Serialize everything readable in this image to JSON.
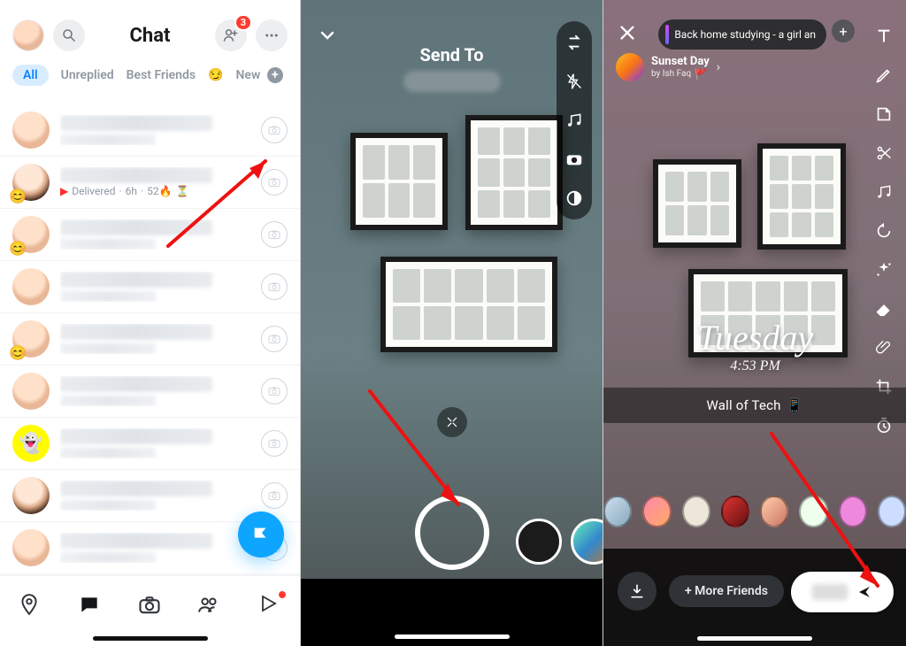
{
  "phone1": {
    "header": {
      "title": "Chat",
      "notif_count": "3"
    },
    "filters": {
      "all": "All",
      "unreplied": "Unreplied",
      "best": "Best Friends",
      "emoji": "😏",
      "new": "New"
    },
    "rows": {
      "row2": {
        "delivered": "Delivered",
        "time": "6h",
        "streak": "52🔥",
        "hourglass": "⏳"
      }
    },
    "tabs": [
      "map",
      "chat",
      "camera",
      "stories",
      "spotlight"
    ]
  },
  "phone2": {
    "title": "Send To",
    "tools": [
      "swap",
      "flash-off",
      "music",
      "camera-roll",
      "contrast"
    ]
  },
  "phone3": {
    "music": "Back home studying - a girl an",
    "sunset_title": "Sunset Day",
    "sunset_by": "by Ish Faq",
    "day_sticker_day": "Tuesday",
    "day_sticker_time": "4:53 PM",
    "caption": "Wall of Tech",
    "more_friends": "+ More Friends",
    "tools": [
      "text",
      "draw",
      "sticker",
      "scissors",
      "music",
      "rewind",
      "sparkle",
      "eraser",
      "attachment",
      "crop",
      "timer"
    ]
  }
}
